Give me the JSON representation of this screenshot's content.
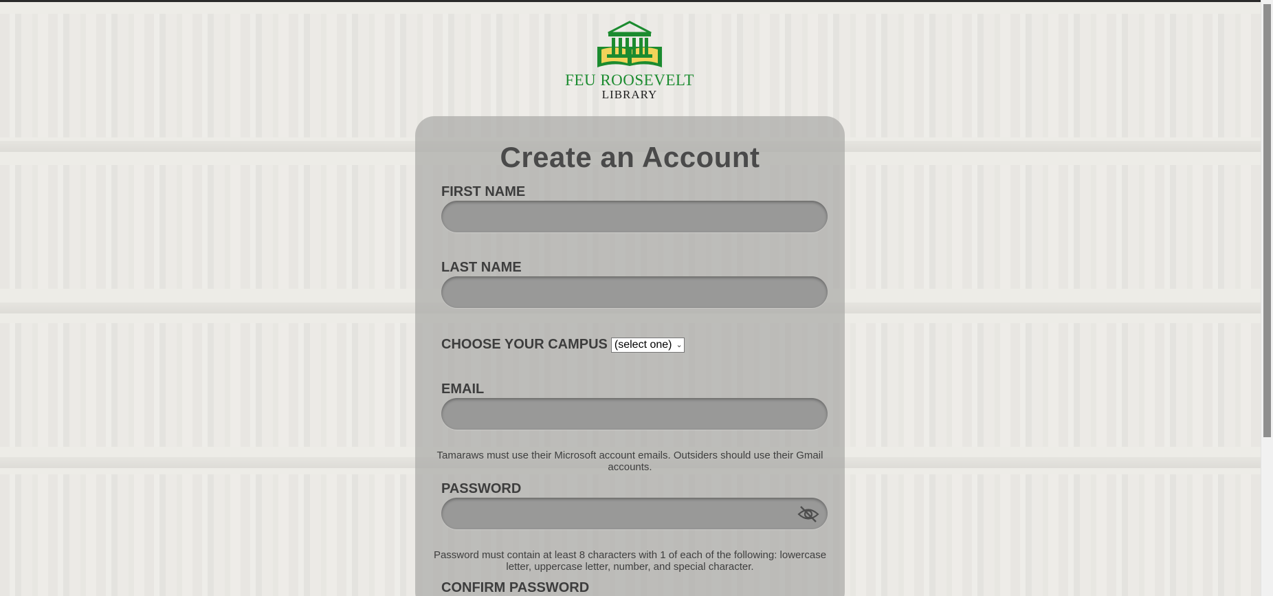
{
  "logo": {
    "line1": "FEU ROOSEVELT",
    "line2": "LIBRARY",
    "colors": {
      "green": "#1b8b2f",
      "gold": "#e8c33a"
    }
  },
  "form": {
    "title": "Create an Account",
    "first_name": {
      "label": "FIRST NAME",
      "value": ""
    },
    "last_name": {
      "label": "LAST NAME",
      "value": ""
    },
    "campus": {
      "label": "CHOOSE YOUR CAMPUS",
      "selected": "(select one)"
    },
    "email": {
      "label": "EMAIL",
      "value": "",
      "note": "Tamaraws must use their Microsoft account emails. Outsiders should use their Gmail accounts."
    },
    "password": {
      "label": "PASSWORD",
      "value": "",
      "note": "Password must contain at least 8 characters with 1 of each of the following: lowercase letter, uppercase letter, number, and special character.",
      "toggle_icon": "eye-slash-icon"
    },
    "confirm_password": {
      "label": "CONFIRM PASSWORD"
    }
  }
}
